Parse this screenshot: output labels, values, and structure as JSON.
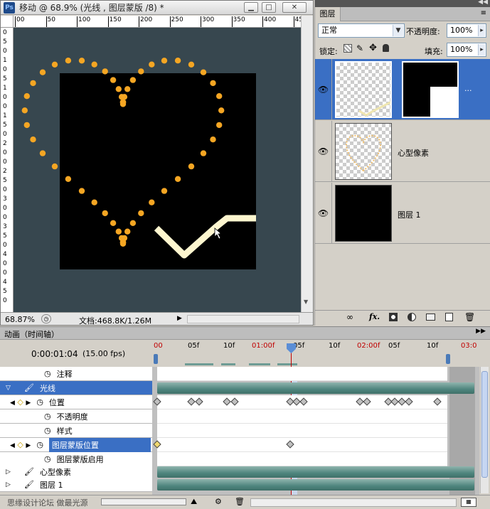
{
  "doc": {
    "title": "移动 @ 68.9% (光线 , 图层蒙版 /8) *",
    "ps_icon": "Ps",
    "ruler_top": [
      "00",
      "50",
      "100",
      "150",
      "200",
      "250",
      "300",
      "350",
      "400",
      "450"
    ],
    "ruler_left": [
      "0",
      "5",
      "0",
      "1",
      "0",
      "5",
      "1",
      "0",
      "0",
      "1",
      "5",
      "0",
      "2",
      "0",
      "0",
      "2",
      "5",
      "0",
      "3",
      "0",
      "0",
      "3",
      "5",
      "0",
      "4",
      "0",
      "0",
      "4",
      "5",
      "0"
    ],
    "zoom": "68.87%",
    "docinfo": "文档:468.8K/1.26M"
  },
  "layers_panel": {
    "tab": "图层",
    "blend_mode": "正常",
    "opacity_label": "不透明度:",
    "opacity_value": "100%",
    "lock_label": "锁定:",
    "fill_label": "填充:",
    "fill_value": "100%",
    "layers": [
      {
        "name": "",
        "selected": true,
        "mask_dots": "···"
      },
      {
        "name": "心型像素",
        "selected": false
      },
      {
        "name": "图层 1",
        "selected": false
      }
    ],
    "bottom_icons": [
      "link-icon",
      "fx-icon",
      "mask-icon",
      "adjustment-icon",
      "group-icon",
      "new-layer-icon",
      "trash-icon"
    ],
    "fx_label": "fx."
  },
  "animation": {
    "tab": "动画（时间轴）",
    "current_time": "0:00:01:04",
    "fps": "(15.00 fps)",
    "ruler_ticks": [
      "00",
      "05f",
      "10f",
      "01:00f",
      "05f",
      "10f",
      "02:00f",
      "05f",
      "10f",
      "03:0"
    ],
    "major_ticks": [
      "00",
      "01:00f",
      "02:00f",
      "03:0"
    ],
    "rows": [
      {
        "label": "注释",
        "type": "prop"
      },
      {
        "label": "光线",
        "type": "layer",
        "selected": true
      },
      {
        "label": "位置",
        "type": "prop",
        "keyed": true
      },
      {
        "label": "不透明度",
        "type": "prop"
      },
      {
        "label": "样式",
        "type": "prop"
      },
      {
        "label": "图层蒙版位置",
        "type": "prop",
        "keyed": true,
        "selected": true
      },
      {
        "label": "图层蒙版启用",
        "type": "prop"
      },
      {
        "label": "心型像素",
        "type": "layer"
      },
      {
        "label": "图层 1",
        "type": "layer"
      }
    ],
    "watermark": "思缘设计论坛 做最光源"
  },
  "colors": {
    "canvas_bg": "#37474f",
    "dot": "#f5a623",
    "line": "#fdf6cf",
    "selection": "#3a6fc4",
    "playhead": "#c00000"
  }
}
